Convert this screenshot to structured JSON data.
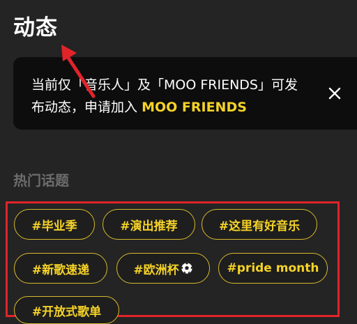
{
  "header": {
    "title": "动态"
  },
  "notice": {
    "text": "当前仅「音乐人」及「MOO FRIENDS」可发布动态，申请加入",
    "link_label": "MOO FRIENDS",
    "close_icon": "close-icon"
  },
  "topics": {
    "title": "热门话题",
    "tags": [
      {
        "label": "#毕业季"
      },
      {
        "label": "#演出推荐"
      },
      {
        "label": "#这里有好音乐"
      },
      {
        "label": "#新歌速递"
      },
      {
        "label": "#欧洲杯",
        "icon": "soccer-ball-icon"
      },
      {
        "label": "#pride month"
      },
      {
        "label": "#开放式歌单"
      }
    ]
  },
  "colors": {
    "accent": "#f5d327",
    "annotation": "#e0242a",
    "background": "#242424",
    "banner": "#0d0d0d"
  }
}
